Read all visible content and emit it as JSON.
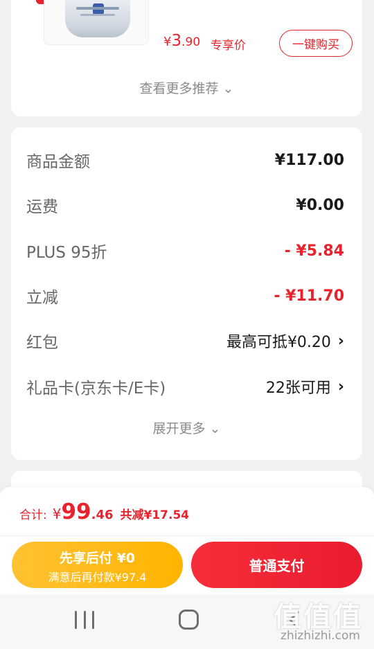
{
  "recommend": {
    "price_currency": "¥",
    "price_int": "3",
    "price_dec": ".90",
    "price_tag": "专享价",
    "buy_button": "一键购买",
    "see_more": "查看更多推荐 ⌄"
  },
  "summary": {
    "rows": [
      {
        "label": "商品金额",
        "value": "¥117.00"
      },
      {
        "label": "运费",
        "value": "¥0.00"
      },
      {
        "label": "PLUS 95折",
        "value": "- ¥5.84"
      },
      {
        "label": "立减",
        "value": "- ¥11.70"
      },
      {
        "label": "红包",
        "value": "最高可抵¥0.20"
      },
      {
        "label": "礼品卡(京东卡/E卡)",
        "value": "22张可用"
      }
    ],
    "expand_more": "展开更多 ⌄"
  },
  "bottom_bar": {
    "total_label": "合计:",
    "total_currency": "¥",
    "total_int": "99",
    "total_dec": ".46",
    "total_saved": "共减¥17.54",
    "pay_later_title": "先享后付 ¥0",
    "pay_later_sub": "满意后再付款¥97.4",
    "pay_button": "普通支付"
  },
  "watermark": {
    "big": "值值值",
    "small": "zhizhizhi.com"
  },
  "colors": {
    "accent_red": "#e8232d",
    "pay_later_yellow": "#ffb400"
  }
}
